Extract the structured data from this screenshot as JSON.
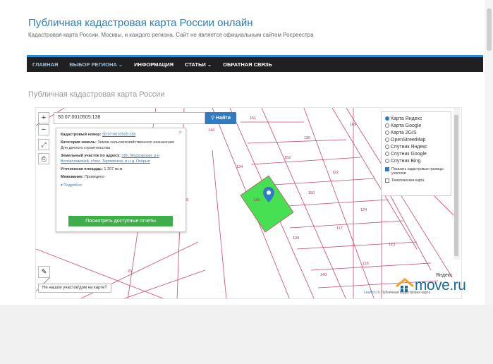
{
  "header": {
    "title": "Публичная кадастровая карта России онлайн",
    "description": "Кадастровая карта России, Москвы, и каждого региона. Сайт не является официальным сайтом Росреестра"
  },
  "nav": {
    "items": [
      {
        "label": "ГЛАВНАЯ"
      },
      {
        "label": "ВЫБОР РЕГИОНА ⌄"
      },
      {
        "label": "ИНФОРМАЦИЯ"
      },
      {
        "label": "СТАТЬИ ⌄"
      },
      {
        "label": "ОБРАТНАЯ СВЯЗЬ"
      }
    ]
  },
  "page_heading": "Публичная кадастровая карта России",
  "map": {
    "search_value": "50:07:0010505:138",
    "search_button": "Найти",
    "zoom_in": "+",
    "zoom_out": "−",
    "popup": {
      "cad_label": "Кадастровый номер:",
      "cad_value": "50:07:0010505:138",
      "category_label": "Категория земель:",
      "category_value": "Земли сельскохозяйственного назначения",
      "use_value": "Для дачного строительства",
      "address_label": "Земельный участок по адресу:",
      "address_value": "обл. Московская, р-н Волоколамский, с/пос. Теряевское, р-н д. Окорыо",
      "area_label": "Уточненная площадь:",
      "area_value": "1 207 кв.м.",
      "survey_label": "Межевание:",
      "survey_value": "Проведено",
      "more": "▾ Подробно",
      "button": "Посмотреть доступные отчеты",
      "close": "×"
    },
    "layers": [
      {
        "label": "Карта Яндекс",
        "selected": true
      },
      {
        "label": "Карта Google",
        "selected": false
      },
      {
        "label": "Карта 2GIS",
        "selected": false
      },
      {
        "label": "OpenStreetMap",
        "selected": false
      },
      {
        "label": "Спутник Яндекс",
        "selected": false
      },
      {
        "label": "Спутник Google",
        "selected": false
      },
      {
        "label": "Спутник Bing",
        "selected": false
      }
    ],
    "checkboxes": [
      {
        "label": "Показать кадастровые границы участков",
        "checked": true
      },
      {
        "label": "Тематическая карта",
        "checked": false
      }
    ],
    "not_found": "Не нашли участок/дом на карте?",
    "attribution_leaflet": "Leaflet",
    "attribution_rest": "| © Публичная кадастровая карта",
    "yandex": "Яндекс",
    "parcel_labels": [
      "151",
      "144",
      "130",
      "169",
      "152",
      "134",
      "122",
      "168",
      "150",
      "124",
      "117",
      "123",
      "116",
      "140",
      "139",
      "138",
      "59",
      "20"
    ],
    "highlight_color": "#47e052"
  },
  "watermark": {
    "text": "move.ru",
    "color": "#1e6a96"
  }
}
